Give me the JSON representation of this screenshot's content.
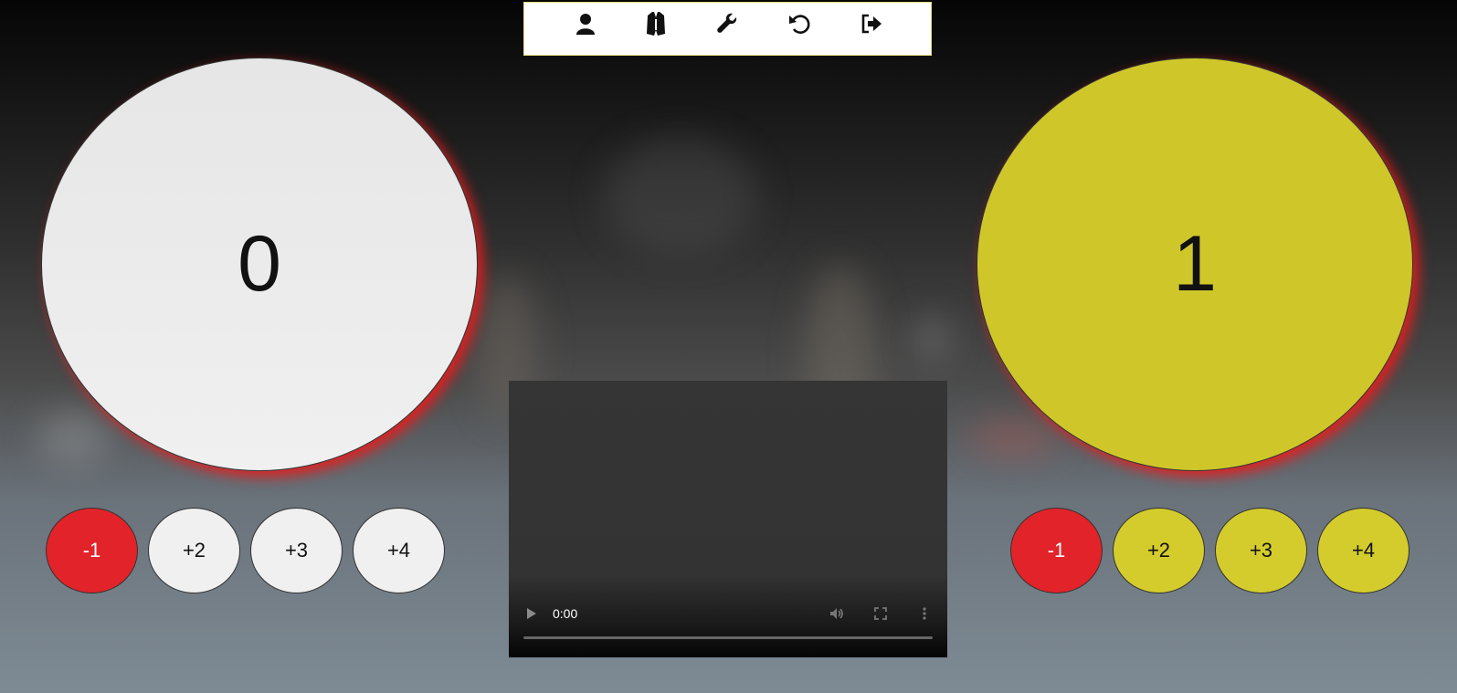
{
  "toolbar": {
    "icons": [
      "user-icon",
      "jersey-icon",
      "wrench-icon",
      "undo-icon",
      "logout-icon"
    ]
  },
  "home": {
    "score": "0",
    "color": "#e9e9e9",
    "buttons": [
      "-1",
      "+2",
      "+3",
      "+4"
    ]
  },
  "away": {
    "score": "1",
    "color": "#cfc72a",
    "buttons": [
      "-1",
      "+2",
      "+3",
      "+4"
    ]
  },
  "video": {
    "time": "0:00",
    "icons": [
      "play-icon",
      "volume-icon",
      "fullscreen-icon",
      "more-icon"
    ]
  },
  "colors": {
    "negative": "#e2232a",
    "glow": "#e61e1e",
    "toolbar_border": "#e8dd7a"
  }
}
